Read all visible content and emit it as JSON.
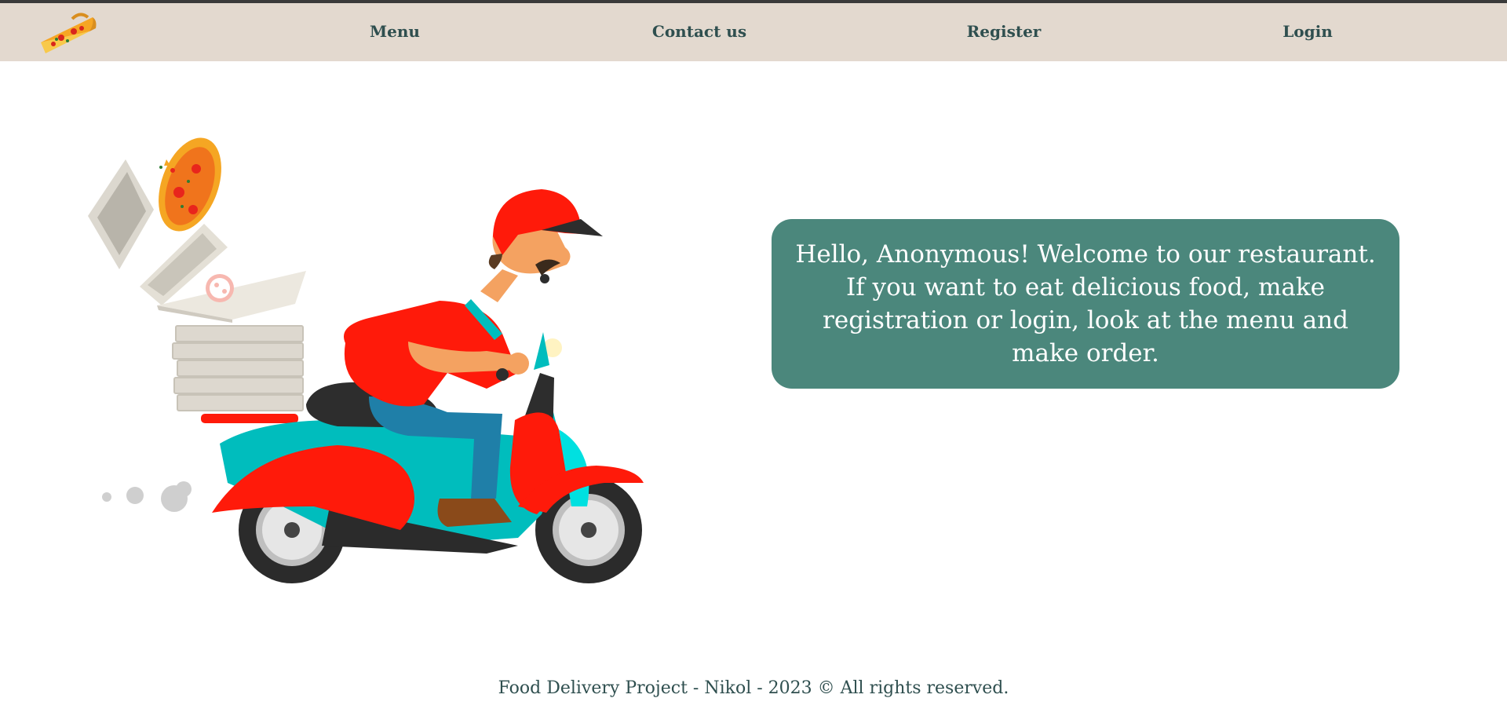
{
  "nav": {
    "logo_icon": "pizza-slice-icon",
    "items": [
      {
        "label": "Menu"
      },
      {
        "label": "Contact us"
      },
      {
        "label": "Register"
      },
      {
        "label": "Login"
      }
    ]
  },
  "hero": {
    "illustration": "pizza-delivery-scooter-illustration"
  },
  "welcome": {
    "message": "Hello, Anonymous! Welcome to our restaurant. If you want to eat delicious food, make registration or login, look at the menu and make order."
  },
  "footer": {
    "text": "Food Delivery Project - Nikol - 2023 © All rights reserved."
  },
  "colors": {
    "header_bg": "#e3d9cf",
    "nav_text": "#2f4f4f",
    "welcome_bg": "#4b877c",
    "welcome_text": "#ffffff",
    "scooter_red": "#ff1a0a",
    "scooter_teal": "#00bdbd"
  }
}
